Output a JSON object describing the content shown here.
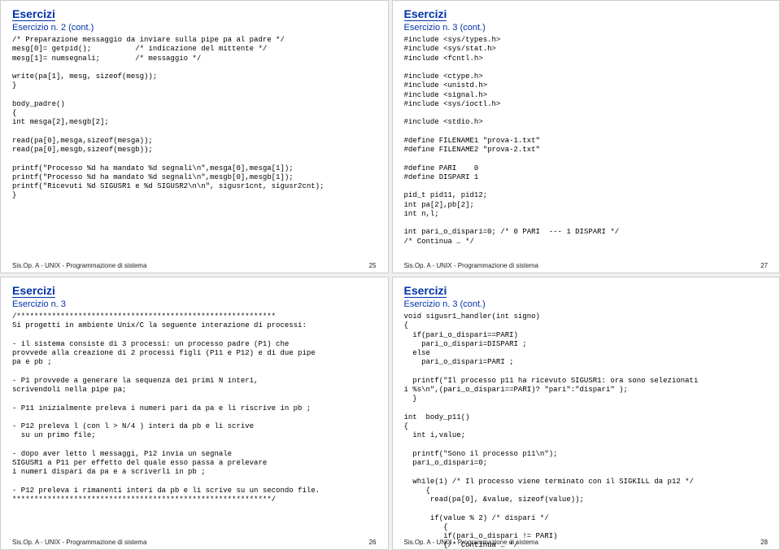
{
  "slides": [
    {
      "heading": "Esercizi",
      "subtitle": "Esercizio n. 2 (cont.)",
      "code": "/* Preparazione messaggio da inviare sulla pipe pa al padre */\nmesg[0]= getpid();          /* indicazione del mittente */\nmesg[1]= numsegnali;        /* messaggio */\n\nwrite(pa[1], mesg, sizeof(mesg));\n}\n\nbody_padre()\n{\nint mesga[2],mesgb[2];\n\nread(pa[0],mesga,sizeof(mesga));\nread(pa[0],mesgb,sizeof(mesgb));\n\nprintf(\"Processo %d ha mandato %d segnali\\n\",mesga[0],mesga[1]);\nprintf(\"Processo %d ha mandato %d segnali\\n\",mesgb[0],mesgb[1]);\nprintf(\"Ricevuti %d SIGUSR1 e %d SIGUSR2\\n\\n\", sigusr1cnt, sigusr2cnt);\n}",
      "footer": "Sis.Op. A - UNIX - Programmazione di sistema",
      "page": "25"
    },
    {
      "heading": "Esercizi",
      "subtitle": "Esercizio n. 3 (cont.)",
      "code": "#include <sys/types.h>\n#include <sys/stat.h>\n#include <fcntl.h>\n\n#include <ctype.h>\n#include <unistd.h>\n#include <signal.h>\n#include <sys/ioctl.h>\n\n#include <stdio.h>\n\n#define FILENAME1 \"prova-1.txt\"\n#define FILENAME2 \"prova-2.txt\"\n\n#define PARI    0\n#define DISPARI 1\n\npid_t pid11, pid12;\nint pa[2],pb[2];\nint n,l;\n\nint pari_o_dispari=0; /* 0 PARI  --- 1 DISPARI */\n/* Continua … */",
      "footer": "Sis.Op. A - UNIX - Programmazione di sistema",
      "page": "27"
    },
    {
      "heading": "Esercizi",
      "subtitle": "Esercizio n. 3",
      "code": "/***********************************************************\nSi progetti in ambiente Unix/C la seguente interazione di processi:\n\n- il sistema consiste di 3 processi: un processo padre (P1) che\nprovvede alla creazione di 2 processi figli (P11 e P12) e di due pipe\npa e pb ;\n\n- P1 provvede a generare la sequenza dei primi N interi,\nscrivendoli nella pipe pa;\n\n- P11 inizialmente preleva i numeri pari da pa e li riscrive in pb ;\n\n- P12 preleva l (con l > N/4 ) interi da pb e li scrive\n  su un primo file;\n\n- dopo aver letto l messaggi, P12 invia un segnale\nSIGUSR1 a P11 per effetto del quale esso passa a prelevare\ni numeri dispari da pa e a scriverli in pb ;\n\n- P12 preleva i rimanenti interi da pb e li scrive su un secondo file.\n***********************************************************/",
      "footer": "Sis.Op. A - UNIX - Programmazione di sistema",
      "page": "26"
    },
    {
      "heading": "Esercizi",
      "subtitle": "Esercizio n. 3 (cont.)",
      "code": "void sigusr1_handler(int signo)\n{\n  if(pari_o_dispari==PARI)\n    pari_o_dispari=DISPARI ;\n  else\n    pari_o_dispari=PARI ;\n\n  printf(\"Il processo p11 ha ricevuto SIGUSR1: ora sono selezionati\ni %s\\n\",(pari_o_dispari==PARI)? \"pari\":\"dispari\" );\n  }\n\nint  body_p11()\n{\n  int i,value;\n\n  printf(\"Sono il processo p11\\n\");\n  pari_o_dispari=0;\n\n  while(1) /* Il processo viene terminato con il SIGKILL da p12 */\n     {\n      read(pa[0], &value, sizeof(value));\n\n      if(value % 2) /* dispari */\n         {\n         if(pari_o_dispari != PARI)\n         {/* Continua … */",
      "footer": "Sis.Op. A - UNIX - Programmazione di sistema",
      "page": "28"
    }
  ]
}
